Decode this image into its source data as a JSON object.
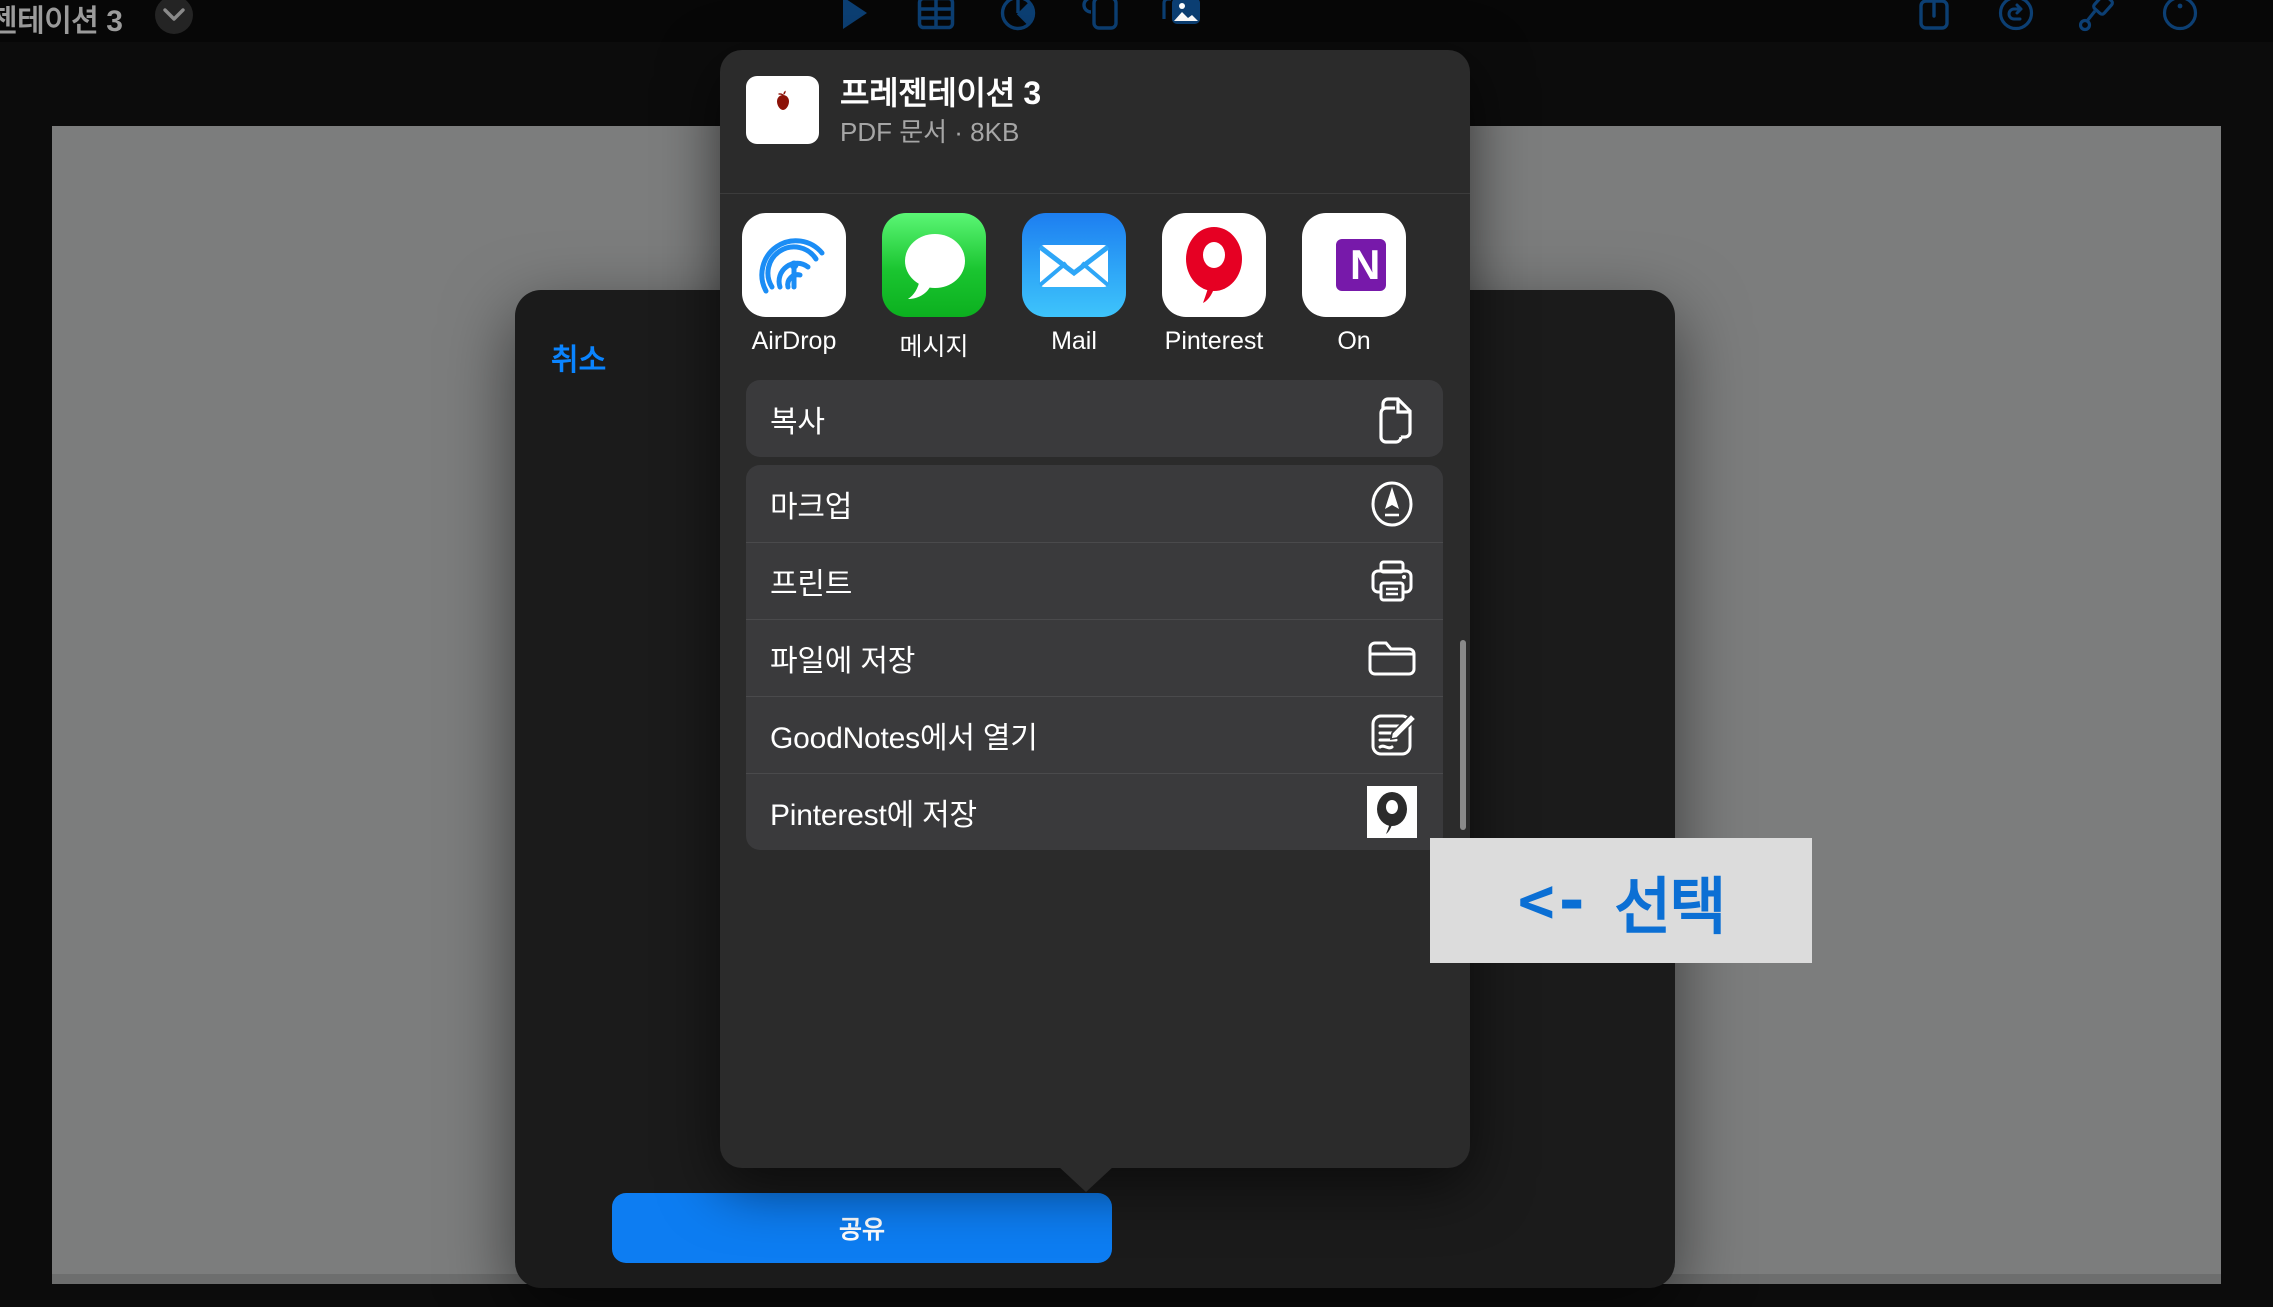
{
  "app": {
    "document_title": "젠테이션 3",
    "toolbar_icons": [
      {
        "name": "play-icon"
      },
      {
        "name": "table-icon"
      },
      {
        "name": "chart-icon"
      },
      {
        "name": "shape-icon"
      },
      {
        "name": "media-icon"
      }
    ],
    "toolbar_right_icons": [
      {
        "name": "share-export-icon"
      },
      {
        "name": "undo-icon"
      },
      {
        "name": "format-brush-icon"
      },
      {
        "name": "more-circle-icon"
      }
    ],
    "accent_color": "#0a84ff",
    "toolbar_icon_color": "#0c3f73",
    "canvas_color": "#7c7d7d"
  },
  "export_dialog": {
    "cancel_label": "취소",
    "share_label": "공유",
    "share_button_color": "#0d7df2"
  },
  "share_sheet": {
    "doc": {
      "name": "프레젠테이션 3",
      "meta": "PDF 문서 · 8KB",
      "thumbnail_icon": "apple-icon"
    },
    "apps": [
      {
        "label": "AirDrop",
        "icon": "airdrop-icon",
        "tile": "white"
      },
      {
        "label": "메시지",
        "icon": "messages-icon",
        "tile": "green"
      },
      {
        "label": "Mail",
        "icon": "mail-icon",
        "tile": "blue"
      },
      {
        "label": "Pinterest",
        "icon": "pinterest-icon",
        "tile": "white"
      },
      {
        "label": "On",
        "icon": "onenote-icon",
        "tile": "white"
      }
    ],
    "group_primary": [
      {
        "label": "복사",
        "icon": "copy-icon"
      }
    ],
    "group_actions": [
      {
        "label": "마크업",
        "icon": "markup-icon"
      },
      {
        "label": "프린트",
        "icon": "printer-icon"
      },
      {
        "label": "파일에 저장",
        "icon": "folder-icon"
      },
      {
        "label": "GoodNotes에서 열기",
        "icon": "goodnotes-icon"
      },
      {
        "label": "Pinterest에 저장",
        "icon": "pinterest-save-icon"
      }
    ]
  },
  "annotation": {
    "arrow": "<-",
    "text": "선택",
    "text_color": "#0b6fd4",
    "background_color": "#dcdcdc"
  }
}
